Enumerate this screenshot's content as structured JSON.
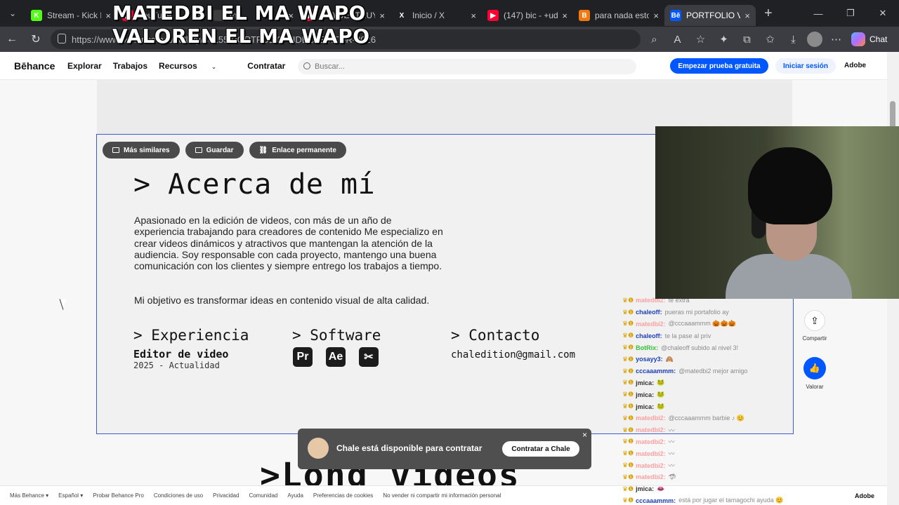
{
  "browser": {
    "tabs": [
      {
        "label": "Stream - Kick D",
        "favicon": "K",
        "favcolor": "#53fc18",
        "active": false
      },
      {
        "label": "YouTube",
        "favicon": "▶",
        "favcolor": "#ff0033",
        "active": false
      },
      {
        "label": "me",
        "favicon": "",
        "favcolor": "#3d3d3d",
        "active": false
      },
      {
        "label": "(11) DESTRUY",
        "favicon": "▶",
        "favcolor": "#ff0033",
        "active": false
      },
      {
        "label": "Inicio / X",
        "favicon": "X",
        "favcolor": "#202124",
        "active": false
      },
      {
        "label": "(147) bic - +ud",
        "favicon": "▶",
        "favcolor": "#ff0033",
        "active": false
      },
      {
        "label": "para nada esto",
        "favicon": "B",
        "favcolor": "#f2790f",
        "active": false
      },
      {
        "label": "PORTFOLIO VII",
        "favicon": "Bē",
        "favcolor": "#0057ff",
        "active": true
      }
    ],
    "url": "https://www.behance.net/gallery/46155/PORTFOLIO-VIDEO-EDITOR-2026",
    "chat_label": "Chat"
  },
  "overlay": {
    "line1": "MATEDBI EL MA WAPO",
    "line2": "VALOREN EL MA WAPO"
  },
  "behance": {
    "logo": "Bēhance",
    "nav": [
      "Explorar",
      "Trabajos",
      "Recursos",
      "Contratar"
    ],
    "search_placeholder": "Buscar...",
    "trial": "Empezar prueba gratuita",
    "login": "Iniciar sesión",
    "adobe": "Adobe"
  },
  "project": {
    "pills": [
      "Más similares",
      "Guardar",
      "Enlace permanente"
    ],
    "about_title": "> Acerca de mí",
    "about_text": "Apasionado en la edición de videos, con más de un año de experiencia trabajando para creadores de contenido Me especializo en crear videos dinámicos y atractivos que mantengan la atención de la audiencia. Soy responsable con cada proyecto, mantengo una buena comunicación con los clientes y siempre entrego los trabajos a tiempo.",
    "about_goal": "Mi objetivo es transformar ideas en contenido visual de alta calidad.",
    "experience_title": "> Experiencia",
    "experience_role": "Editor de video",
    "experience_date": "2025 - Actualidad",
    "software_title": "> Software",
    "software": [
      "Pr",
      "Ae",
      "✂"
    ],
    "contact_title": "> Contacto",
    "contact_email": "chaledition@gmail.com",
    "next_section": ">Long videos"
  },
  "side": {
    "share": "Compartir",
    "like": "Valorar"
  },
  "toast": {
    "message": "Chale está disponible para contratar",
    "button": "Contratar a Chale",
    "close": "×"
  },
  "footer": {
    "links": [
      "Más Behance ▾",
      "Español ▾",
      "Probar Behance Pro",
      "Condiciones de uso",
      "Privacidad",
      "Comunidad",
      "Ayuda",
      "Preferencias de cookies",
      "No vender ni compartir mi información personal"
    ],
    "adobe": "Adobe"
  },
  "chat": [
    {
      "user": "matedbi2:",
      "color": "#ffa0a0",
      "text": "te extra"
    },
    {
      "user": "chaleoff:",
      "color": "#1e3fbf",
      "text": "pueras mi portafolio ay"
    },
    {
      "user": "matedbi2:",
      "color": "#ffa0a0",
      "text": "@cccaaammm 🎃🎃🎃"
    },
    {
      "user": "chaleoff:",
      "color": "#1e3fbf",
      "text": "te la pase al priv"
    },
    {
      "user": "BotRix:",
      "color": "#35c13b",
      "text": "@chaleoff subido al nivel 3!"
    },
    {
      "user": "yosayy3:",
      "color": "#1e3fbf",
      "text": "🙈"
    },
    {
      "user": "cccaaammm:",
      "color": "#1e3fbf",
      "text": "@matedbi2 mejor amigo"
    },
    {
      "user": "jmica:",
      "color": "#333333",
      "text": "🐸"
    },
    {
      "user": "jmica:",
      "color": "#333333",
      "text": "🐸"
    },
    {
      "user": "jmica:",
      "color": "#333333",
      "text": "🐸"
    },
    {
      "user": "matedbi2:",
      "color": "#ffa0a0",
      "text": "@cccaaammm barbie ♪ 😊"
    },
    {
      "user": "matedbi2:",
      "color": "#ffa0a0",
      "text": "〰"
    },
    {
      "user": "matedbi2:",
      "color": "#ffa0a0",
      "text": "〰"
    },
    {
      "user": "matedbi2:",
      "color": "#ffa0a0",
      "text": "〰"
    },
    {
      "user": "matedbi2:",
      "color": "#ffa0a0",
      "text": "〰"
    },
    {
      "user": "matedbi2:",
      "color": "#ffa0a0",
      "text": "🦈"
    },
    {
      "user": "jmica:",
      "color": "#333333",
      "text": "👄"
    },
    {
      "user": "cccaaammm:",
      "color": "#1e3fbf",
      "text": "está por jugar el tamagochi ayuda 😊"
    }
  ]
}
